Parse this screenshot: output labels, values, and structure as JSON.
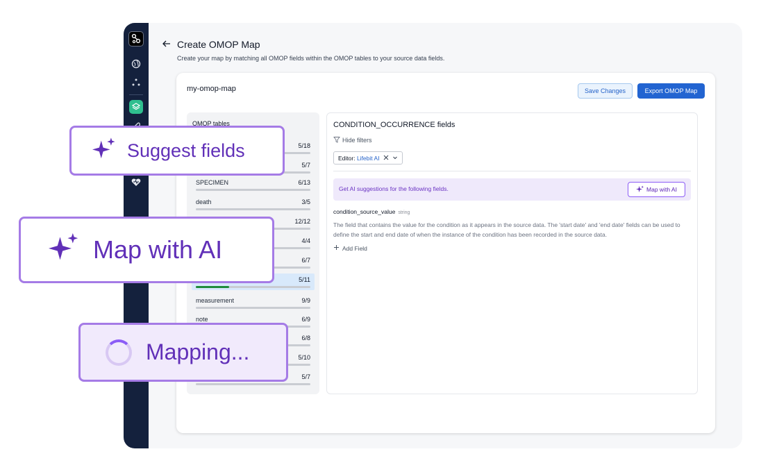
{
  "header": {
    "title": "Create OMOP Map",
    "subtitle": "Create your map by matching all OMOP fields within the OMOP tables to your source data fields."
  },
  "card": {
    "map_name": "my-omop-map",
    "save_label": "Save Changes",
    "export_label": "Export OMOP Map"
  },
  "tables": {
    "heading": "OMOP tables",
    "items": [
      {
        "name": "",
        "count": "5/18",
        "progress": 0.28
      },
      {
        "name": "",
        "count": "5/7",
        "progress": 0.71
      },
      {
        "name": "SPECIMEN",
        "count": "6/13",
        "progress": 0
      },
      {
        "name": "death",
        "count": "3/5",
        "progress": 0
      },
      {
        "name": "",
        "count": "12/12",
        "progress": 0
      },
      {
        "name": "",
        "count": "4/4",
        "progress": 0
      },
      {
        "name": "",
        "count": "6/7",
        "progress": 0
      },
      {
        "name": "",
        "count": "5/11",
        "progress": 0.29,
        "selected": true
      },
      {
        "name": "measurement",
        "count": "9/9",
        "progress": 0
      },
      {
        "name": "note",
        "count": "6/9",
        "progress": 0
      },
      {
        "name": "",
        "count": "6/8",
        "progress": 0
      },
      {
        "name": "",
        "count": "5/10",
        "progress": 0
      },
      {
        "name": "",
        "count": "5/7",
        "progress": 0
      }
    ]
  },
  "fields_panel": {
    "title": "CONDITION_OCCURRENCE fields",
    "hide_filters": "Hide filters",
    "editor_label": "Editor:",
    "editor_value": "Lifebit AI",
    "ai_banner_text": "Get AI suggestions for the following fields.",
    "ai_button": "Map with AI",
    "field_name": "condition_source_value",
    "field_type": "string",
    "field_description": "The field that contains the value for the condition as it appears in the source data. The 'start date' and 'end date' fields can be used to define the start and end date of when the instance of the condition has been recorded in the source data.",
    "add_field": "Add Field"
  },
  "callouts": {
    "suggest": "Suggest fields",
    "map_ai": "Map with AI",
    "mapping": "Mapping..."
  },
  "colors": {
    "accent_purple": "#6130b8",
    "primary_blue": "#2264d1",
    "progress_green": "#1e8a3c",
    "rail": "#14213d"
  }
}
